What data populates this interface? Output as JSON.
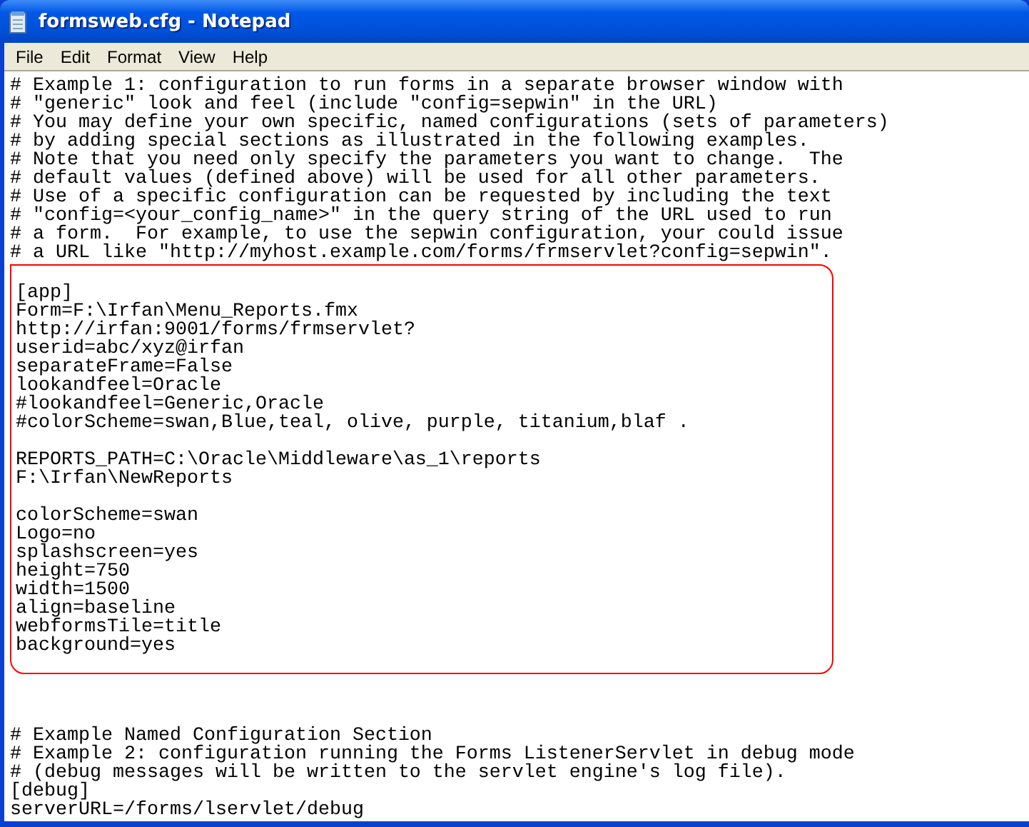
{
  "window": {
    "title": "formsweb.cfg - Notepad"
  },
  "menu": [
    "File",
    "Edit",
    "Format",
    "View",
    "Help"
  ],
  "editor": {
    "blocks": [
      {
        "kind": "plain",
        "paragraphs": [
          [
            "# Example 1: configuration to run forms in a separate browser window with",
            "# \"generic\" look and feel (include \"config=sepwin\" in the URL)",
            "# You may define your own specific, named configurations (sets of parameters)",
            "# by adding special sections as illustrated in the following examples.",
            "# Note that you need only specify the parameters you want to change.  The",
            "# default values (defined above) will be used for all other parameters.",
            "# Use of a specific configuration can be requested by including the text",
            "# \"config=<your_config_name>\" in the query string of the URL used to run",
            "# a form.  For example, to use the sepwin configuration, your could issue",
            "# a URL like \"http://myhost.example.com/forms/frmservlet?config=sepwin\"."
          ]
        ]
      },
      {
        "kind": "highlighted",
        "paragraphs": [
          [
            "[app]",
            "Form=F:\\Irfan\\Menu_Reports.fmx",
            "http://irfan:9001/forms/frmservlet?",
            "userid=abc/xyz@irfan",
            "separateFrame=False",
            "lookandfeel=Oracle",
            "#lookandfeel=Generic,Oracle",
            "#colorScheme=swan,Blue,teal, olive, purple, titanium,blaf ."
          ],
          [
            "REPORTS_PATH=C:\\Oracle\\Middleware\\as_1\\reports",
            "F:\\Irfan\\NewReports"
          ],
          [
            "colorScheme=swan",
            "Logo=no",
            "splashscreen=yes",
            "height=750",
            "width=1500",
            "align=baseline",
            "webformsTile=title",
            "background=yes"
          ]
        ]
      },
      {
        "kind": "plain",
        "paragraphs": [
          [
            "# Example Named Configuration Section",
            "# Example 2: configuration running the Forms ListenerServlet in debug mode",
            "# (debug messages will be written to the servlet engine's log file).",
            "[debug]",
            "serverURL=/forms/lservlet/debug"
          ]
        ]
      }
    ]
  }
}
